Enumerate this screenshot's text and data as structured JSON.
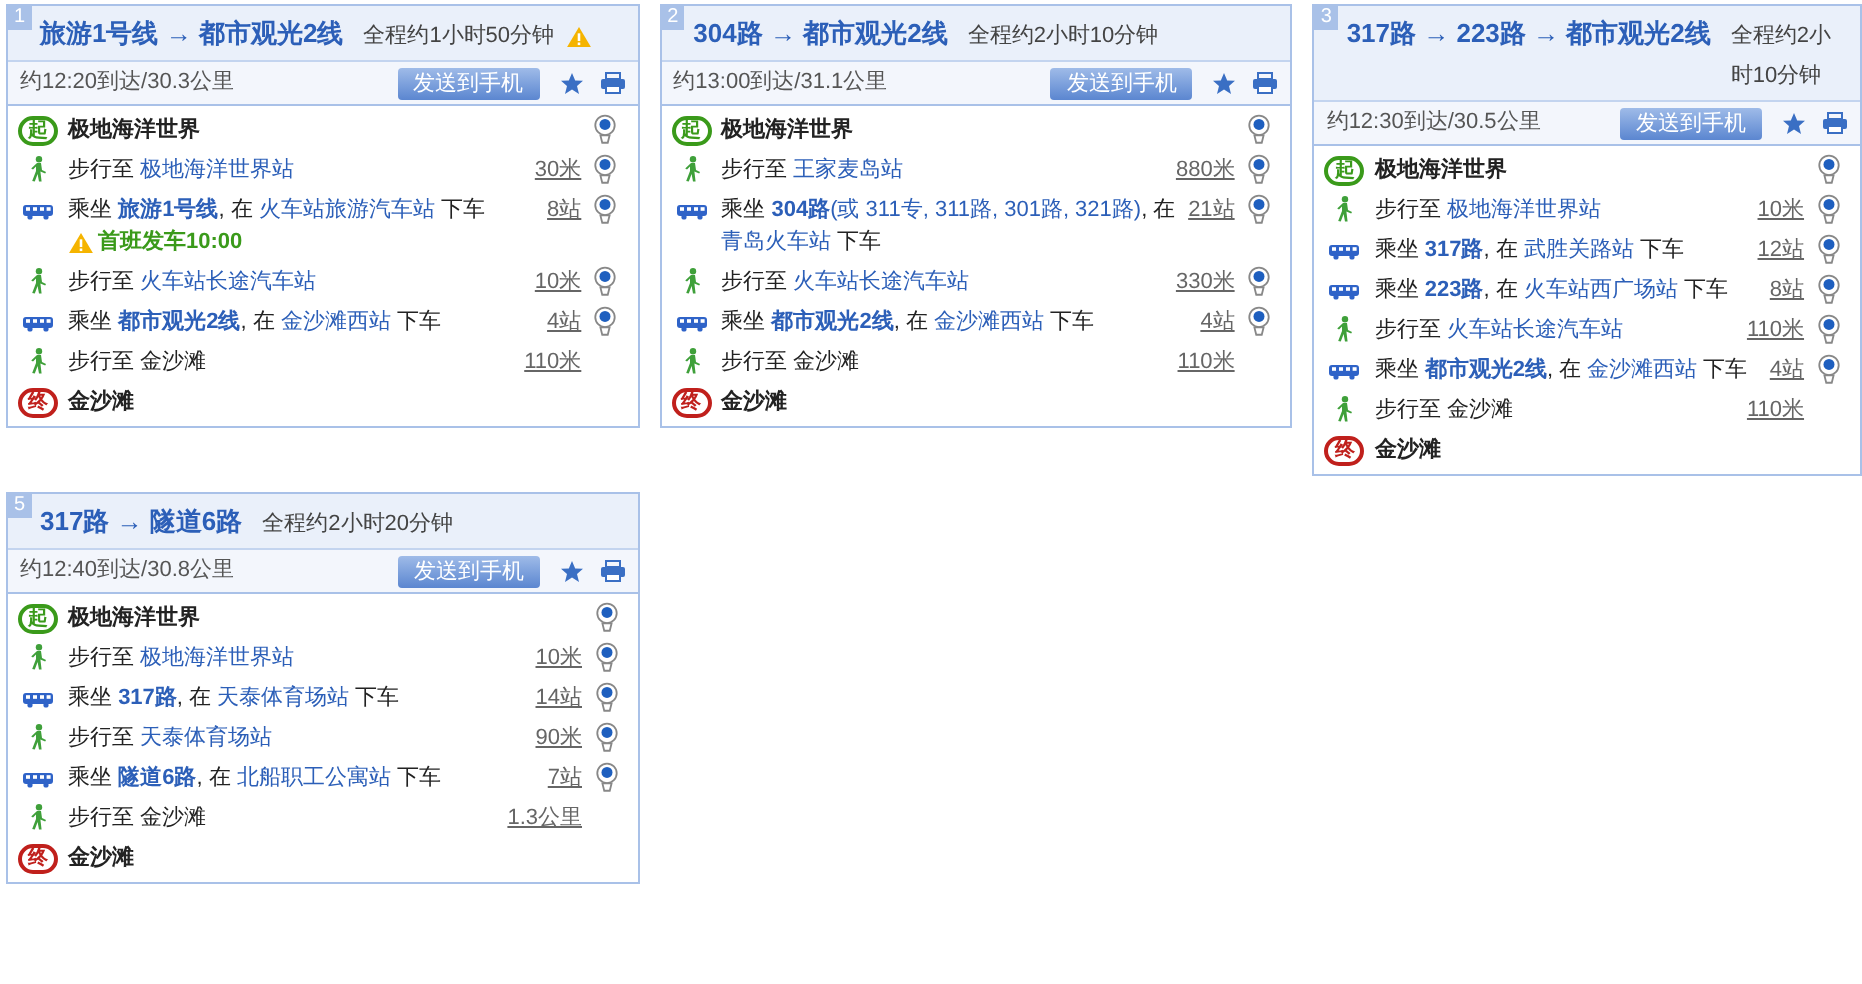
{
  "rows": [
    {
      "cards": [
        {
          "number": "1",
          "title": "旅游1号线 → 都市观光2线",
          "duration": "全程约1小时50分钟",
          "warning": true,
          "arrival": "约12:20到达/30.3公里",
          "send_button": "发送到手机",
          "steps": [
            {
              "kind": "start",
              "badge": "起",
              "name": "极地海洋世界",
              "pin": true
            },
            {
              "kind": "walk",
              "segments": [
                {
                  "kind": "plain",
                  "text": "步行至 "
                },
                {
                  "kind": "link",
                  "text": "极地海洋世界站"
                }
              ],
              "distance": "30米",
              "pin": true
            },
            {
              "kind": "bus",
              "segments": [
                {
                  "kind": "plain",
                  "text": "乘坐 "
                },
                {
                  "kind": "route",
                  "text": "旅游1号线"
                },
                {
                  "kind": "plain",
                  "text": ", 在 "
                },
                {
                  "kind": "link",
                  "text": "火车站旅游汽车站"
                },
                {
                  "kind": "plain",
                  "text": " 下车"
                }
              ],
              "note": "首班发车10:00",
              "distance": "8站",
              "pin": true
            },
            {
              "kind": "walk",
              "segments": [
                {
                  "kind": "plain",
                  "text": "步行至 "
                },
                {
                  "kind": "link",
                  "text": "火车站长途汽车站"
                }
              ],
              "distance": "10米",
              "pin": true
            },
            {
              "kind": "bus",
              "segments": [
                {
                  "kind": "plain",
                  "text": "乘坐 "
                },
                {
                  "kind": "route",
                  "text": "都市观光2线"
                },
                {
                  "kind": "plain",
                  "text": ", 在 "
                },
                {
                  "kind": "link",
                  "text": "金沙滩西站"
                },
                {
                  "kind": "plain",
                  "text": " 下车"
                }
              ],
              "distance": "4站",
              "pin": true
            },
            {
              "kind": "walk",
              "segments": [
                {
                  "kind": "plain",
                  "text": "步行至 金沙滩"
                }
              ],
              "distance": "110米",
              "pin": false
            },
            {
              "kind": "end",
              "badge": "终",
              "name": "金沙滩",
              "pin": false
            }
          ]
        },
        {
          "number": "2",
          "title": "304路 → 都市观光2线",
          "duration": "全程约2小时10分钟",
          "warning": false,
          "arrival": "约13:00到达/31.1公里",
          "send_button": "发送到手机",
          "steps": [
            {
              "kind": "start",
              "badge": "起",
              "name": "极地海洋世界",
              "pin": true
            },
            {
              "kind": "walk",
              "segments": [
                {
                  "kind": "plain",
                  "text": "步行至 "
                },
                {
                  "kind": "link",
                  "text": "王家麦岛站"
                }
              ],
              "distance": "880米",
              "pin": true
            },
            {
              "kind": "bus",
              "segments": [
                {
                  "kind": "plain",
                  "text": "乘坐 "
                },
                {
                  "kind": "route",
                  "text": "304路"
                },
                {
                  "kind": "link",
                  "text": "(或 311专, 311路, 301路, 321路)"
                },
                {
                  "kind": "plain",
                  "text": ", 在 "
                },
                {
                  "kind": "link",
                  "text": "青岛火车站"
                },
                {
                  "kind": "plain",
                  "text": " 下车"
                }
              ],
              "distance": "21站",
              "pin": true
            },
            {
              "kind": "walk",
              "segments": [
                {
                  "kind": "plain",
                  "text": "步行至 "
                },
                {
                  "kind": "link",
                  "text": "火车站长途汽车站"
                }
              ],
              "distance": "330米",
              "pin": true
            },
            {
              "kind": "bus",
              "segments": [
                {
                  "kind": "plain",
                  "text": "乘坐 "
                },
                {
                  "kind": "route",
                  "text": "都市观光2线"
                },
                {
                  "kind": "plain",
                  "text": ", 在 "
                },
                {
                  "kind": "link",
                  "text": "金沙滩西站"
                },
                {
                  "kind": "plain",
                  "text": " 下车"
                }
              ],
              "distance": "4站",
              "pin": true
            },
            {
              "kind": "walk",
              "segments": [
                {
                  "kind": "plain",
                  "text": "步行至 金沙滩"
                }
              ],
              "distance": "110米",
              "pin": false
            },
            {
              "kind": "end",
              "badge": "终",
              "name": "金沙滩",
              "pin": false
            }
          ]
        },
        {
          "number": "3",
          "title": "317路 → 223路 → 都市观光2线",
          "duration": "全程约2小时10分钟",
          "warning": false,
          "arrival": "约12:30到达/30.5公里",
          "send_button": "发送到手机",
          "steps": [
            {
              "kind": "start",
              "badge": "起",
              "name": "极地海洋世界",
              "pin": true
            },
            {
              "kind": "walk",
              "segments": [
                {
                  "kind": "plain",
                  "text": "步行至 "
                },
                {
                  "kind": "link",
                  "text": "极地海洋世界站"
                }
              ],
              "distance": "10米",
              "pin": true
            },
            {
              "kind": "bus",
              "segments": [
                {
                  "kind": "plain",
                  "text": "乘坐 "
                },
                {
                  "kind": "route",
                  "text": "317路"
                },
                {
                  "kind": "plain",
                  "text": ", 在 "
                },
                {
                  "kind": "link",
                  "text": "武胜关路站"
                },
                {
                  "kind": "plain",
                  "text": " 下车"
                }
              ],
              "distance": "12站",
              "pin": true
            },
            {
              "kind": "bus",
              "segments": [
                {
                  "kind": "plain",
                  "text": "乘坐 "
                },
                {
                  "kind": "route",
                  "text": "223路"
                },
                {
                  "kind": "plain",
                  "text": ", 在 "
                },
                {
                  "kind": "link",
                  "text": "火车站西广场站"
                },
                {
                  "kind": "plain",
                  "text": " 下车"
                }
              ],
              "distance": "8站",
              "pin": true
            },
            {
              "kind": "walk",
              "segments": [
                {
                  "kind": "plain",
                  "text": "步行至 "
                },
                {
                  "kind": "link",
                  "text": "火车站长途汽车站"
                }
              ],
              "distance": "110米",
              "pin": true
            },
            {
              "kind": "bus",
              "segments": [
                {
                  "kind": "plain",
                  "text": "乘坐 "
                },
                {
                  "kind": "route",
                  "text": "都市观光2线"
                },
                {
                  "kind": "plain",
                  "text": ", 在 "
                },
                {
                  "kind": "link",
                  "text": "金沙滩西站"
                },
                {
                  "kind": "plain",
                  "text": " 下车"
                }
              ],
              "distance": "4站",
              "pin": true
            },
            {
              "kind": "walk",
              "segments": [
                {
                  "kind": "plain",
                  "text": "步行至 金沙滩"
                }
              ],
              "distance": "110米",
              "pin": false
            },
            {
              "kind": "end",
              "badge": "终",
              "name": "金沙滩",
              "pin": false
            }
          ]
        }
      ]
    },
    {
      "cards": [
        {
          "number": "5",
          "title": "317路 → 隧道6路",
          "duration": "全程约2小时20分钟",
          "warning": false,
          "arrival": "约12:40到达/30.8公里",
          "send_button": "发送到手机",
          "steps": [
            {
              "kind": "start",
              "badge": "起",
              "name": "极地海洋世界",
              "pin": true
            },
            {
              "kind": "walk",
              "segments": [
                {
                  "kind": "plain",
                  "text": "步行至 "
                },
                {
                  "kind": "link",
                  "text": "极地海洋世界站"
                }
              ],
              "distance": "10米",
              "pin": true
            },
            {
              "kind": "bus",
              "segments": [
                {
                  "kind": "plain",
                  "text": "乘坐 "
                },
                {
                  "kind": "route",
                  "text": "317路"
                },
                {
                  "kind": "plain",
                  "text": ", 在 "
                },
                {
                  "kind": "link",
                  "text": "天泰体育场站"
                },
                {
                  "kind": "plain",
                  "text": " 下车"
                }
              ],
              "distance": "14站",
              "pin": true
            },
            {
              "kind": "walk",
              "segments": [
                {
                  "kind": "plain",
                  "text": "步行至 "
                },
                {
                  "kind": "link",
                  "text": "天泰体育场站"
                }
              ],
              "distance": "90米",
              "pin": true
            },
            {
              "kind": "bus",
              "segments": [
                {
                  "kind": "plain",
                  "text": "乘坐 "
                },
                {
                  "kind": "route",
                  "text": "隧道6路"
                },
                {
                  "kind": "plain",
                  "text": ", 在 "
                },
                {
                  "kind": "link",
                  "text": "北船职工公寓站"
                },
                {
                  "kind": "plain",
                  "text": " 下车"
                }
              ],
              "distance": "7站",
              "pin": true
            },
            {
              "kind": "walk",
              "segments": [
                {
                  "kind": "plain",
                  "text": "步行至 金沙滩"
                }
              ],
              "distance": "1.3公里",
              "pin": false
            },
            {
              "kind": "end",
              "badge": "终",
              "name": "金沙滩",
              "pin": false
            }
          ]
        }
      ]
    }
  ]
}
